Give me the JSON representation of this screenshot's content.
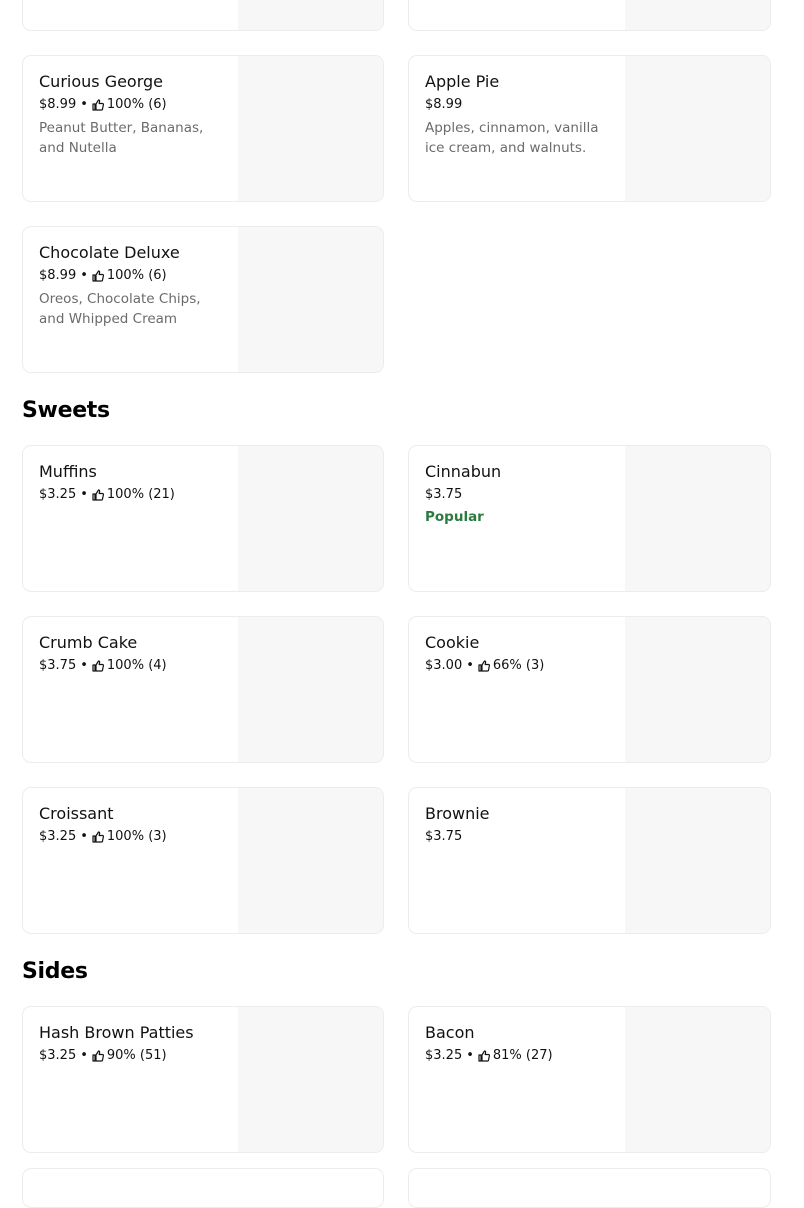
{
  "sections": {
    "sweets_title": "Sweets",
    "sides_title": "Sides"
  },
  "items": {
    "curious_george": {
      "name": "Curious George",
      "price": "$8.99",
      "rating": "100% (6)",
      "description": "Peanut Butter, Bananas, and Nutella"
    },
    "apple_pie": {
      "name": "Apple Pie",
      "price": "$8.99",
      "description": "Apples, cinnamon, vanilla ice cream, and walnuts."
    },
    "chocolate_deluxe": {
      "name": "Chocolate Deluxe",
      "price": "$8.99",
      "rating": "100% (6)",
      "description": "Oreos, Chocolate Chips, and Whipped Cream"
    },
    "muffins": {
      "name": "Muffins",
      "price": "$3.25",
      "rating": "100% (21)"
    },
    "cinnabun": {
      "name": "Cinnabun",
      "price": "$3.75",
      "badge": "Popular"
    },
    "crumb_cake": {
      "name": "Crumb Cake",
      "price": "$3.75",
      "rating": "100% (4)"
    },
    "cookie": {
      "name": "Cookie",
      "price": "$3.00",
      "rating": "66% (3)"
    },
    "croissant": {
      "name": "Croissant",
      "price": "$3.25",
      "rating": "100% (3)"
    },
    "brownie": {
      "name": "Brownie",
      "price": "$3.75"
    },
    "hash_brown_patties": {
      "name": "Hash Brown Patties",
      "price": "$3.25",
      "rating": "90% (51)"
    },
    "bacon": {
      "name": "Bacon",
      "price": "$3.25",
      "rating": "81% (27)"
    }
  },
  "icons": {
    "rating": "thumbs-up-icon"
  },
  "colors": {
    "popular": "#2c7a3e",
    "description": "#6b6b6b",
    "image_placeholder": "#f7f7f7"
  }
}
